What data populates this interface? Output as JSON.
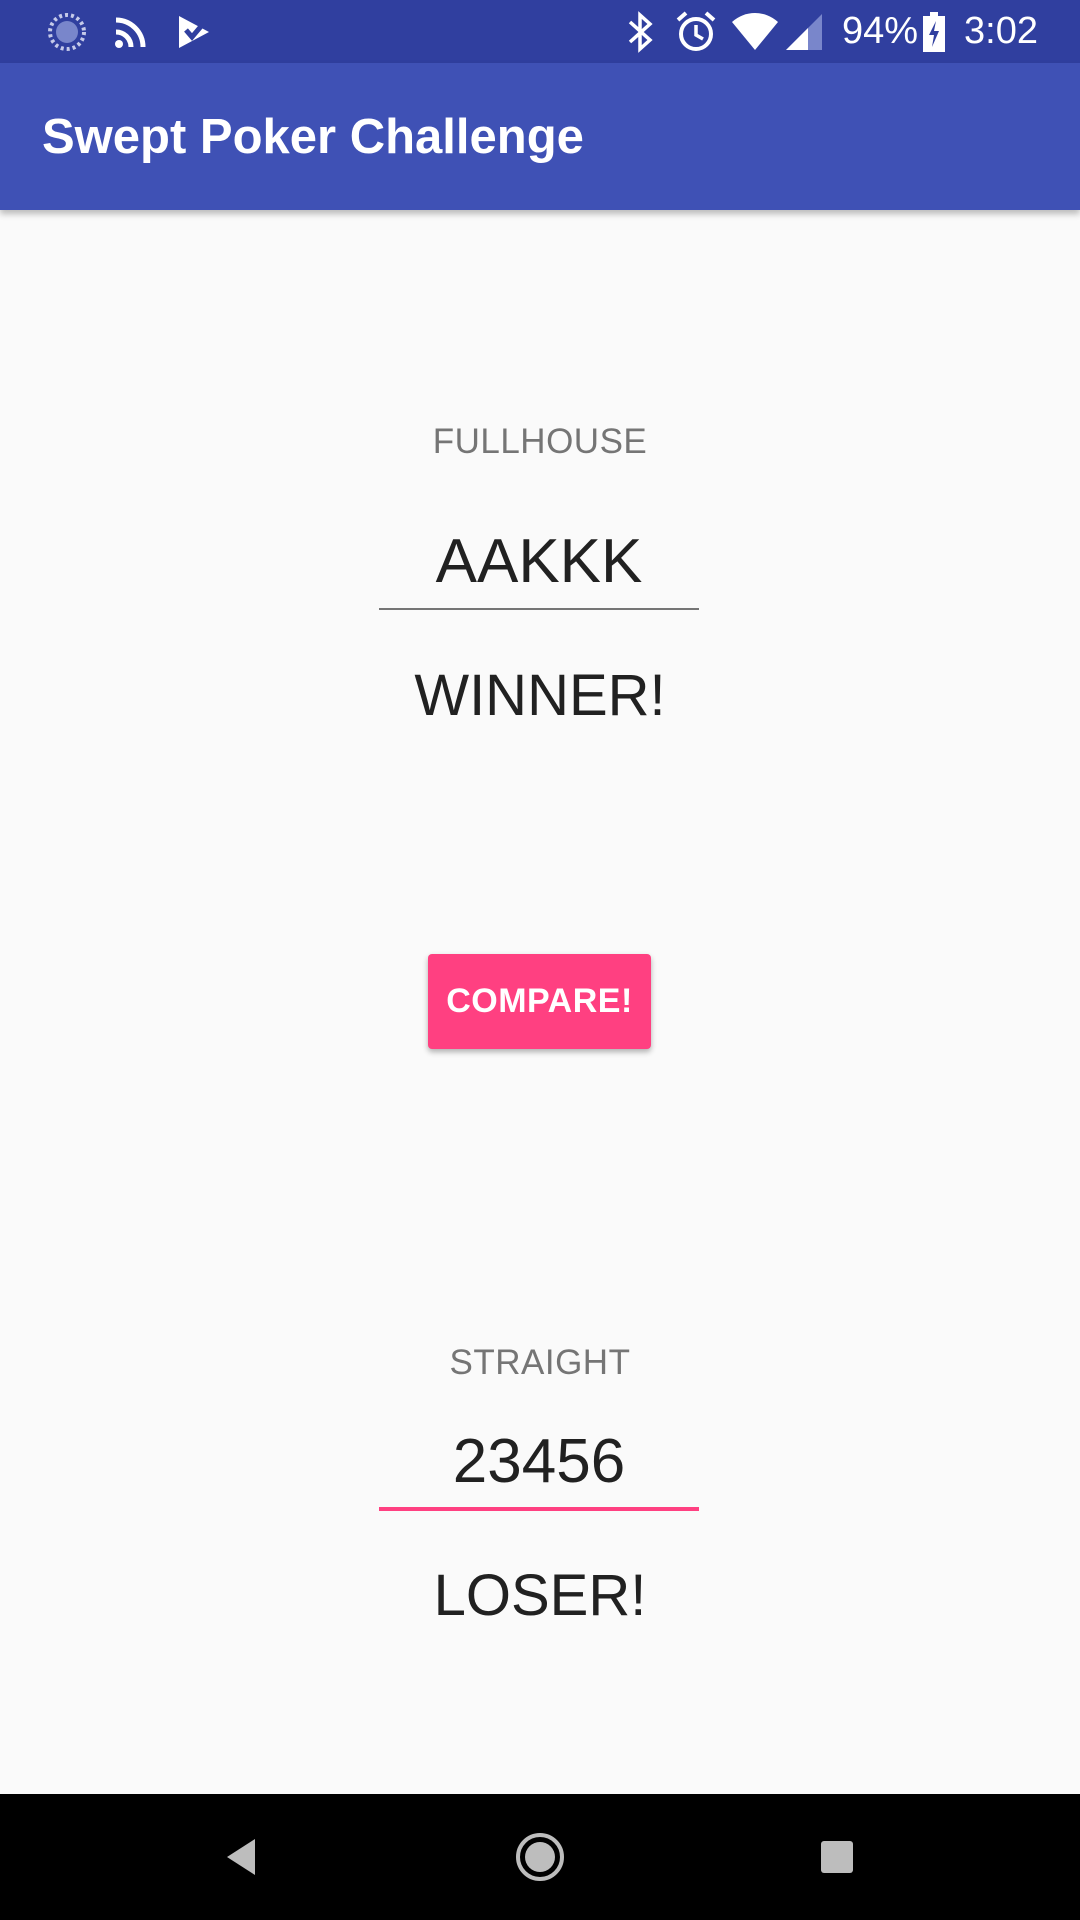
{
  "status_bar": {
    "battery_percent": "94%",
    "time": "3:02",
    "icons": [
      "loading-icon",
      "cast-icon",
      "checkmark-app-icon",
      "bluetooth-icon",
      "alarm-icon",
      "wifi-icon",
      "signal-icon",
      "battery-icon"
    ]
  },
  "app_bar": {
    "title": "Swept Poker Challenge"
  },
  "hand1": {
    "type_label": "FULLHOUSE",
    "value": "AAKKK",
    "result": "WINNER!"
  },
  "compare_button": {
    "label": "COMPARE!"
  },
  "hand2": {
    "type_label": "STRAIGHT",
    "value": "23456",
    "result": "LOSER!"
  },
  "nav_bar": {
    "icons": [
      "back-icon",
      "home-icon",
      "recents-icon"
    ]
  },
  "colors": {
    "primary_dark": "#303f9f",
    "primary": "#3f51b5",
    "accent": "#ff4081",
    "background": "#fafafa"
  }
}
